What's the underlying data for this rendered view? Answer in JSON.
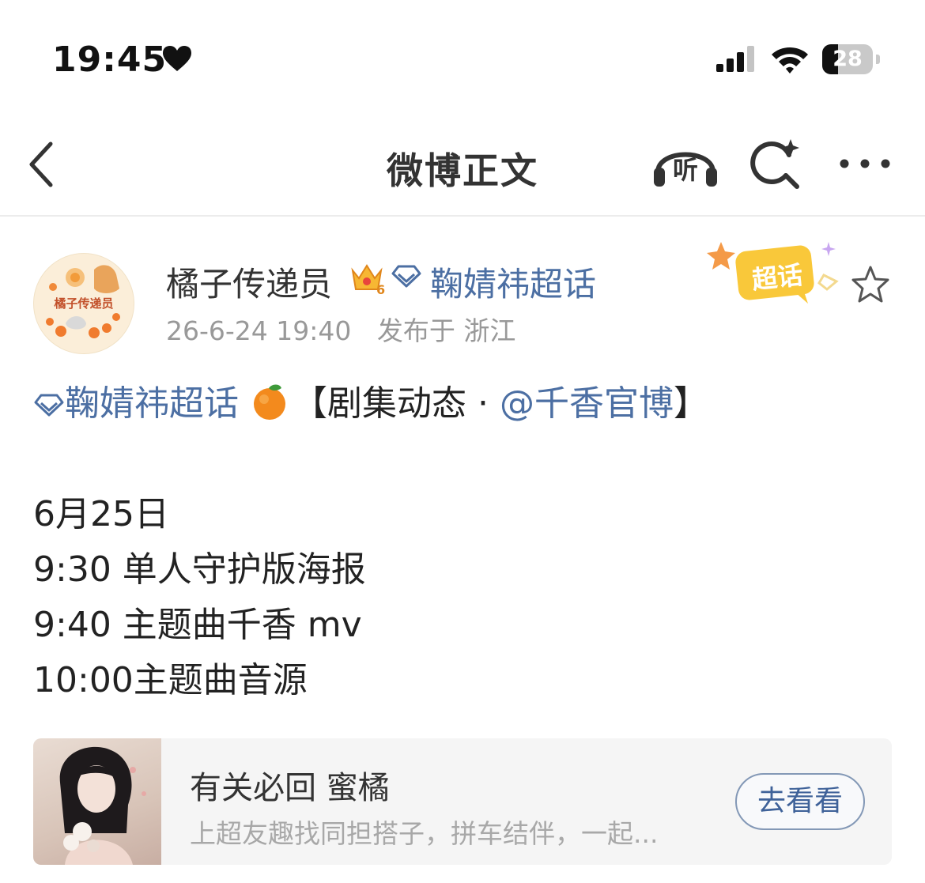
{
  "status_bar": {
    "time": "19:45",
    "battery": "28"
  },
  "nav": {
    "title": "微博正文",
    "listen_label": "听"
  },
  "post": {
    "username": "橘子传递员",
    "crown_level": "6",
    "topic_header": "鞠婧祎超话",
    "date": "26-6-24 19:40",
    "location": "发布于 浙江",
    "supertopic_badge": "超话",
    "avatar_label": "橘子传递员"
  },
  "content": {
    "topic": "鞠婧祎超话",
    "bracket_prefix": "【剧集动态 · ",
    "mention": "@千香官博",
    "bracket_suffix": "】",
    "lines": [
      "6月25日",
      "9:30 单人守护版海报",
      "9:40 主题曲千香 mv",
      "10:00主题曲音源"
    ]
  },
  "card": {
    "title": "有关必回 蜜橘",
    "subtitle": "上超友趣找同担搭子，拼车结伴，一起...",
    "button": "去看看"
  },
  "colors": {
    "link": "#4c6fa3",
    "meta": "#999999",
    "card_bg": "#f5f5f5"
  }
}
